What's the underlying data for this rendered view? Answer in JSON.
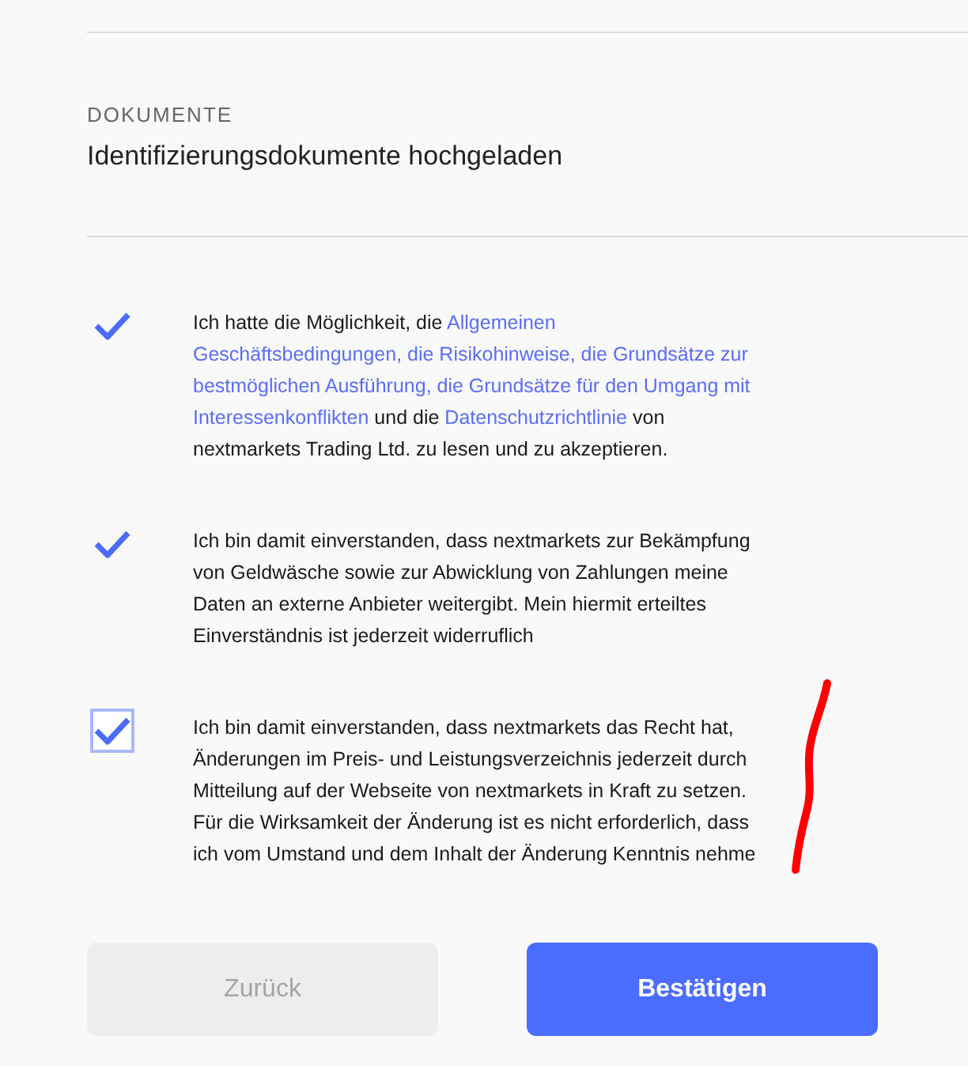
{
  "section": {
    "label": "DOKUMENTE",
    "title": "Identifizierungsdokumente hochgeladen"
  },
  "consents": [
    {
      "checked": true,
      "focused": false,
      "parts": [
        {
          "kind": "text",
          "text": "Ich hatte die Möglichkeit, die"
        },
        {
          "kind": "link",
          "text": "Allgemeinen"
        },
        {
          "kind": "link",
          "text": "Geschäftsbedingungen, die Risikohinweise, die Grundsätze zur"
        },
        {
          "kind": "link",
          "text": "bestmöglichen Ausführung, die Grundsätze für den Umgang mit"
        },
        {
          "kind": "link",
          "text": "Interessenkonflikten"
        },
        {
          "kind": "text",
          "text": "und die"
        },
        {
          "kind": "link",
          "text": "Datenschutzrichtlinie"
        },
        {
          "kind": "text",
          "text": "von nextmarkets Trading Ltd. zu lesen und zu akzeptieren."
        }
      ]
    },
    {
      "checked": true,
      "focused": false,
      "parts": [
        {
          "kind": "text",
          "text": "Ich bin damit einverstanden, dass nextmarkets zur Bekämpfung von Geldwäsche sowie zur Abwicklung von Zahlungen meine Daten an externe Anbieter weitergibt. Mein hiermit erteiltes Einverständnis ist jederzeit widerruflich"
        }
      ]
    },
    {
      "checked": true,
      "focused": true,
      "parts": [
        {
          "kind": "text",
          "text": "Ich bin damit einverstanden, dass nextmarkets das Recht hat, Änderungen im Preis- und Leistungsverzeichnis jederzeit durch Mitteilung auf der Webseite von nextmarkets in Kraft zu setzen. Für die Wirksamkeit der Änderung ist es nicht erforderlich, dass ich vom Umstand und dem Inhalt der Änderung Kenntnis nehme"
        }
      ]
    }
  ],
  "buttons": [
    {
      "label": "Zurück",
      "disabled": true
    },
    {
      "label": "Bestätigen",
      "disabled": false
    }
  ]
}
